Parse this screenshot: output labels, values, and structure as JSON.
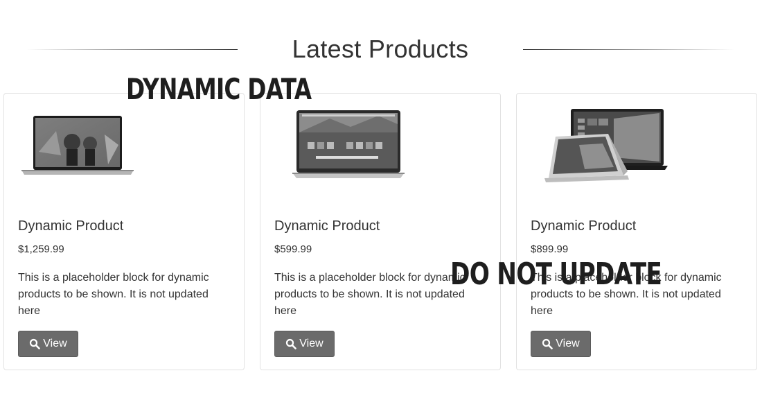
{
  "section": {
    "title": "Latest Products"
  },
  "overlays": {
    "top_stamp": "DYNAMIC DATA",
    "middle_stamp": "DO NOT UPDATE"
  },
  "products": [
    {
      "title": "Dynamic Product",
      "price": "$1,259.99",
      "description": "This is a placeholder block for dynamic products to be shown. It is not updated here",
      "button_label": "View",
      "image": "laptop-thin-bezel-image"
    },
    {
      "title": "Dynamic Product",
      "price": "$599.99",
      "description": "This is a placeholder block for dynamic products to be shown. It is not updated here",
      "button_label": "View",
      "image": "laptop-silver-image"
    },
    {
      "title": "Dynamic Product",
      "price": "$899.99",
      "description": "This is a placeholder block for dynamic products to be shown. It is not updated here",
      "button_label": "View",
      "image": "laptop-2in1-image"
    }
  ],
  "colors": {
    "button_bg": "#6b6b6b",
    "card_border": "#e2e2e2",
    "text": "#333333"
  }
}
